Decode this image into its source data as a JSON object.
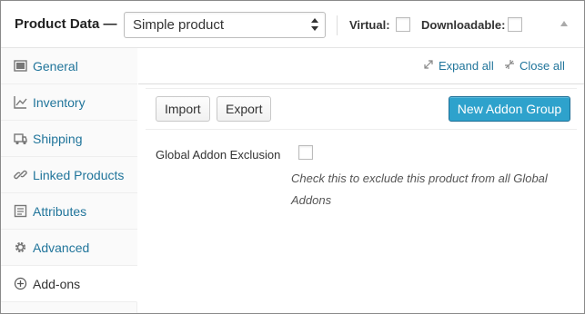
{
  "header": {
    "title": "Product Data —",
    "product_type": "Simple product",
    "virtual_label": "Virtual:",
    "downloadable_label": "Downloadable:"
  },
  "sidebar": {
    "items": [
      {
        "label": "General",
        "icon": "general-icon"
      },
      {
        "label": "Inventory",
        "icon": "inventory-icon"
      },
      {
        "label": "Shipping",
        "icon": "shipping-icon"
      },
      {
        "label": "Linked Products",
        "icon": "link-icon"
      },
      {
        "label": "Attributes",
        "icon": "attributes-icon"
      },
      {
        "label": "Advanced",
        "icon": "gear-icon"
      },
      {
        "label": "Add-ons",
        "icon": "plus-circle-icon",
        "active": true
      }
    ]
  },
  "main": {
    "expand_all": "Expand all",
    "close_all": "Close all",
    "import_label": "Import",
    "export_label": "Export",
    "new_group_label": "New Addon Group",
    "exclusion_label": "Global Addon Exclusion",
    "exclusion_desc": "Check this to exclude this product from all Global Addons"
  },
  "colors": {
    "link": "#21759b",
    "primary_button": "#2ea2cc"
  }
}
